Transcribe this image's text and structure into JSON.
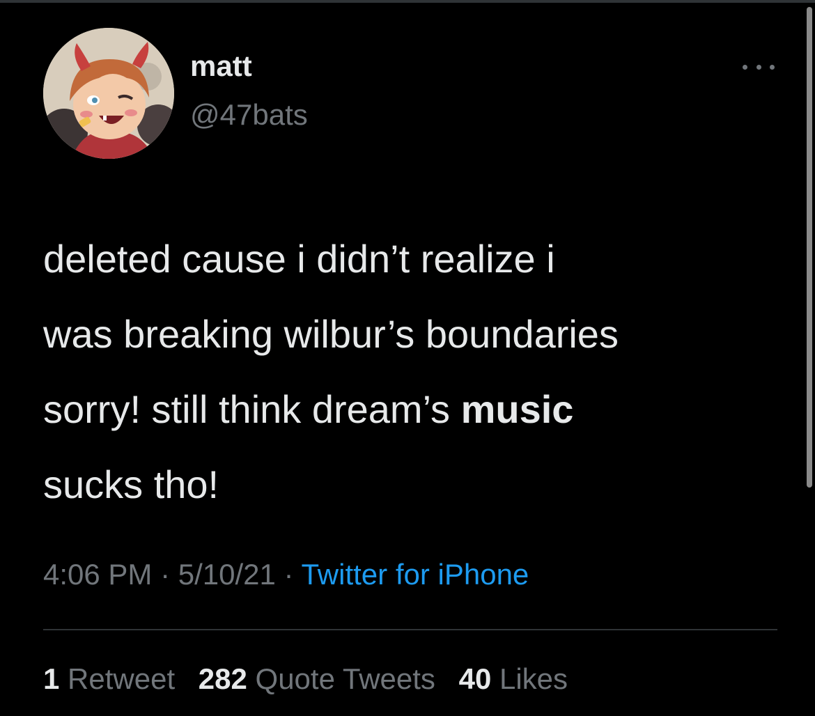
{
  "tweet": {
    "display_name": "matt",
    "handle": "@47bats",
    "avatar_icon": "user-avatar-illustration",
    "more_icon": "more-options-icon",
    "text_lines": [
      "deleted cause i didn’t realize i",
      "was breaking wilbur’s boundaries",
      "sorry! still think dream’s ",
      "music",
      "sucks tho!"
    ],
    "time": "4:06 PM",
    "separator": " · ",
    "date": "5/10/21",
    "source": "Twitter for iPhone",
    "stats": {
      "retweets_count": "1",
      "retweets_label": "Retweet",
      "quotes_count": "282",
      "quotes_label": "Quote Tweets",
      "likes_count": "40",
      "likes_label": "Likes"
    }
  },
  "colors": {
    "background": "#000000",
    "primary_text": "#e7e9ea",
    "secondary_text": "#71767b",
    "link": "#1d9bf0",
    "divider": "#2f3336"
  }
}
